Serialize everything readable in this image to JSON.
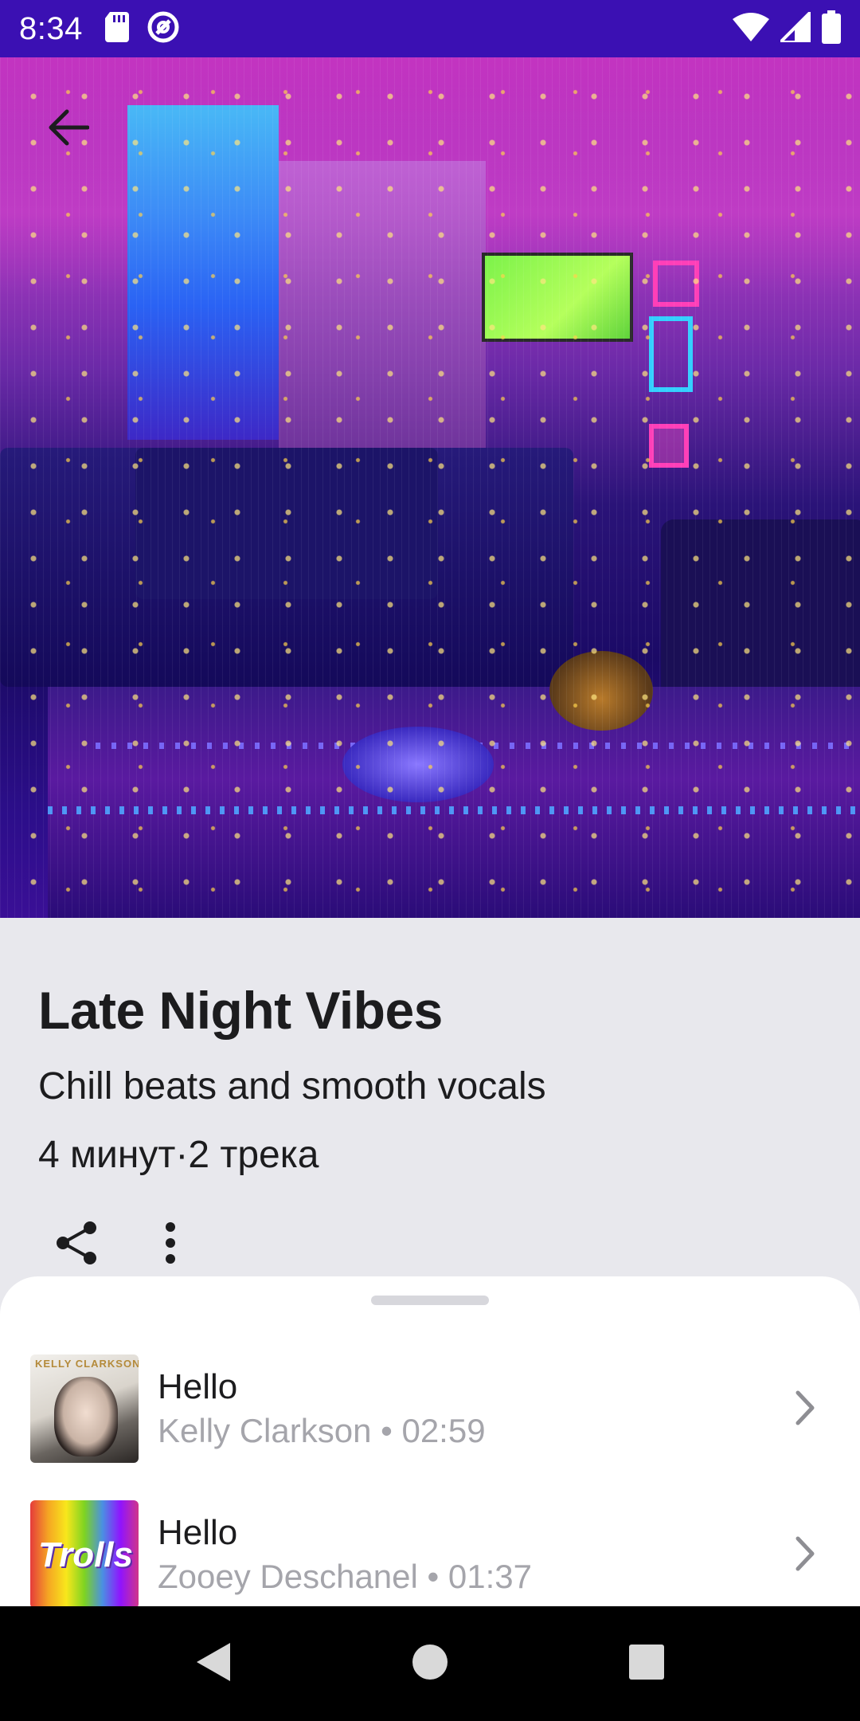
{
  "status_bar": {
    "time": "8:34",
    "icons": [
      "sd-card-icon",
      "sync-icon",
      "wifi-icon",
      "signal-icon",
      "battery-icon"
    ]
  },
  "header": {
    "back_icon": "back-arrow-icon"
  },
  "playlist": {
    "title": "Late Night Vibes",
    "subtitle": "Chill beats and smooth vocals",
    "meta": "4 минут·2 трека",
    "actions": [
      "share-icon",
      "more-vertical-icon"
    ]
  },
  "tracks": [
    {
      "title": "Hello",
      "subtitle": "Kelly Clarkson • 02:59",
      "cover_text": "KELLY CLARKSON"
    },
    {
      "title": "Hello",
      "subtitle": "Zooey Deschanel • 01:37",
      "cover_text": "Trolls"
    }
  ],
  "nav": [
    "back-triangle-icon",
    "home-circle-icon",
    "recents-square-icon"
  ],
  "colors": {
    "status_bar": "#3b10b3",
    "background": "#e8e8ed",
    "sheet": "#ffffff",
    "text_primary": "#1c1c1e",
    "text_secondary": "#a5a5ab"
  }
}
